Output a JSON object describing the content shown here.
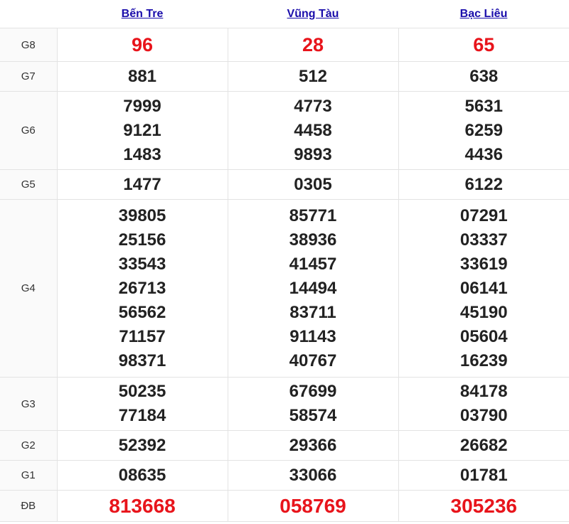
{
  "provinces": [
    "Bến Tre",
    "Vũng Tàu",
    "Bạc Liêu"
  ],
  "colors": {
    "special": "#e8141b",
    "normal": "#222222",
    "link": "#1a0dab"
  },
  "rows": [
    {
      "label": "G8",
      "values": [
        [
          "96"
        ],
        [
          "28"
        ],
        [
          "65"
        ]
      ]
    },
    {
      "label": "G7",
      "values": [
        [
          "881"
        ],
        [
          "512"
        ],
        [
          "638"
        ]
      ]
    },
    {
      "label": "G6",
      "values": [
        [
          "7999",
          "9121",
          "1483"
        ],
        [
          "4773",
          "4458",
          "9893"
        ],
        [
          "5631",
          "6259",
          "4436"
        ]
      ]
    },
    {
      "label": "G5",
      "values": [
        [
          "1477"
        ],
        [
          "0305"
        ],
        [
          "6122"
        ]
      ]
    },
    {
      "label": "G4",
      "values": [
        [
          "39805",
          "25156",
          "33543",
          "26713",
          "56562",
          "71157",
          "98371"
        ],
        [
          "85771",
          "38936",
          "41457",
          "14494",
          "83711",
          "91143",
          "40767"
        ],
        [
          "07291",
          "03337",
          "33619",
          "06141",
          "45190",
          "05604",
          "16239"
        ]
      ]
    },
    {
      "label": "G3",
      "values": [
        [
          "50235",
          "77184"
        ],
        [
          "67699",
          "58574"
        ],
        [
          "84178",
          "03790"
        ]
      ]
    },
    {
      "label": "G2",
      "values": [
        [
          "52392"
        ],
        [
          "29366"
        ],
        [
          "26682"
        ]
      ]
    },
    {
      "label": "G1",
      "values": [
        [
          "08635"
        ],
        [
          "33066"
        ],
        [
          "01781"
        ]
      ]
    },
    {
      "label": "ĐB",
      "values": [
        [
          "813668"
        ],
        [
          "058769"
        ],
        [
          "305236"
        ]
      ]
    }
  ]
}
